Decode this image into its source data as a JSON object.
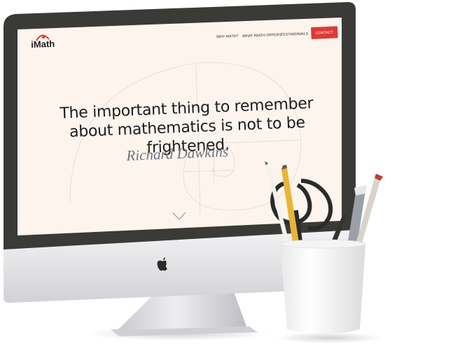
{
  "site": {
    "logo": "iMath",
    "nav": [
      {
        "label": "WHY MATH?"
      },
      {
        "label": "WHAT IMATH OFFERS"
      },
      {
        "label": "TESTIMONIALS"
      }
    ],
    "contact_label": "CONTACT",
    "quote": "The important thing to remember about mathematics is not to be frightened.",
    "author": "Richard Dawkins"
  },
  "colors": {
    "screen_bg": "#fdf4ee",
    "bezel": "#3a3a37",
    "accent": "#e03a35",
    "author": "#6a7480",
    "stand": "#d9d9dd"
  },
  "icons": {
    "logo_mark": "heart-arc-icon",
    "scroll": "chevron-down-icon",
    "device": "apple-logo-icon"
  }
}
